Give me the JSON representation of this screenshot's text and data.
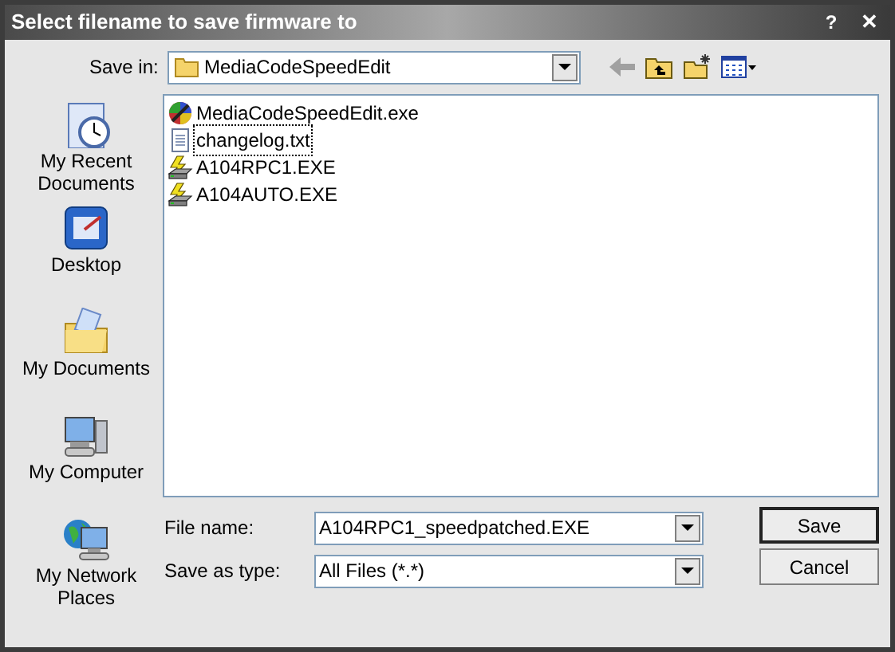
{
  "window": {
    "title": "Select filename to save firmware to",
    "help_button": "?",
    "close_button": "✕"
  },
  "save_in": {
    "label": "Save in:",
    "value": "MediaCodeSpeedEdit"
  },
  "places": [
    {
      "kind": "recent",
      "label": "My Recent Documents"
    },
    {
      "kind": "desktop",
      "label": "Desktop"
    },
    {
      "kind": "documents",
      "label": "My Documents"
    },
    {
      "kind": "computer",
      "label": "My Computer"
    },
    {
      "kind": "network",
      "label": "My Network Places"
    }
  ],
  "files": [
    {
      "kind": "app",
      "name": "MediaCodeSpeedEdit.exe",
      "focused": false
    },
    {
      "kind": "text",
      "name": "changelog.txt",
      "focused": true
    },
    {
      "kind": "flash",
      "name": "A104RPC1.EXE",
      "focused": false
    },
    {
      "kind": "flash",
      "name": "A104AUTO.EXE",
      "focused": false
    }
  ],
  "file_name": {
    "label": "File name:",
    "value": "A104RPC1_speedpatched.EXE"
  },
  "save_as_type": {
    "label": "Save as type:",
    "value": "All Files (*.*)"
  },
  "buttons": [
    {
      "kind": "default",
      "label": "Save"
    },
    {
      "kind": "normal",
      "label": "Cancel"
    }
  ]
}
